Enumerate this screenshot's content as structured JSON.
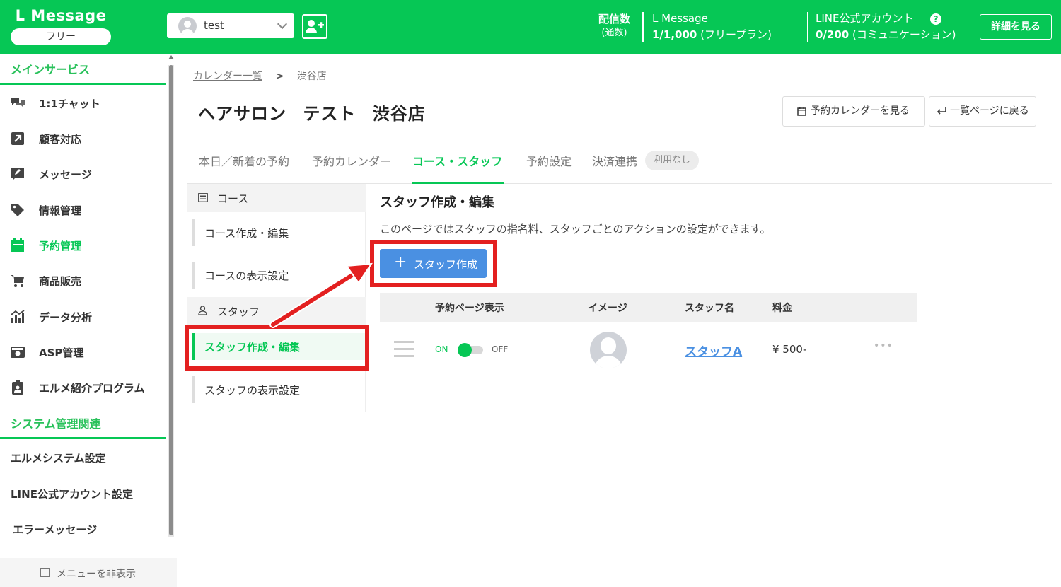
{
  "header": {
    "brand": "L Message",
    "plan": "フリー",
    "account_name": "test",
    "stats": {
      "delivery_title": "配信数",
      "delivery_sub": "(通数)",
      "lmessage_title": "L Message",
      "lmessage_value": "1/1,000",
      "lmessage_plan": "(フリープラン)",
      "line_title": "LINE公式アカウント",
      "line_value": "0/200",
      "line_plan": "(コミュニケーション)"
    },
    "help_icon": "?",
    "details_button": "詳細を見る"
  },
  "sidebar": {
    "main_section": "メインサービス",
    "items": [
      {
        "label": "1:1チャット",
        "icon": "chat-icon"
      },
      {
        "label": "顧客対応",
        "icon": "external-link-icon"
      },
      {
        "label": "メッセージ",
        "icon": "message-edit-icon"
      },
      {
        "label": "情報管理",
        "icon": "tag-icon"
      },
      {
        "label": "予約管理",
        "icon": "calendar-icon"
      },
      {
        "label": "商品販売",
        "icon": "cart-icon"
      },
      {
        "label": "データ分析",
        "icon": "chart-icon"
      },
      {
        "label": "ASP管理",
        "icon": "asp-icon"
      },
      {
        "label": "エルメ紹介プログラム",
        "icon": "clipboard-user-icon"
      }
    ],
    "system_section": "システム管理関連",
    "system_items": [
      "エルメシステム設定",
      "LINE公式アカウント設定",
      "エラーメッセージ"
    ],
    "hide_menu": "メニューを非表示"
  },
  "breadcrumb": {
    "parent": "カレンダー一覧",
    "separator": ">",
    "current": "渋谷店"
  },
  "page": {
    "title": "ヘアサロン テスト 渋谷店",
    "view_calendar_button": "予約カレンダーを見る",
    "back_button": "一覧ページに戻る"
  },
  "tabs": [
    "本日／新着の予約",
    "予約カレンダー",
    "コース・スタッフ",
    "予約設定",
    "決済連携"
  ],
  "tab_badge": "利用なし",
  "subnav": {
    "course_head": "コース",
    "course_items": [
      "コース作成・編集",
      "コースの表示設定"
    ],
    "staff_head": "スタッフ",
    "staff_items": [
      "スタッフ作成・編集",
      "スタッフの表示設定"
    ]
  },
  "content": {
    "title": "スタッフ作成・編集",
    "description": "このページではスタッフの指名料、スタッフごとのアクションの設定ができます。",
    "create_button": "スタッフ作成",
    "create_plus": "+",
    "columns": [
      "予約ページ表示",
      "イメージ",
      "スタッフ名",
      "料金"
    ],
    "rows": [
      {
        "toggle_on": "ON",
        "toggle_off": "OFF",
        "state": "on",
        "staff_name": "スタッフA",
        "fee": "¥ 500-",
        "more": "•••"
      }
    ]
  },
  "colors": {
    "brand_green": "#06c755",
    "link_blue": "#4a90e2",
    "highlight_red": "#e32020"
  }
}
